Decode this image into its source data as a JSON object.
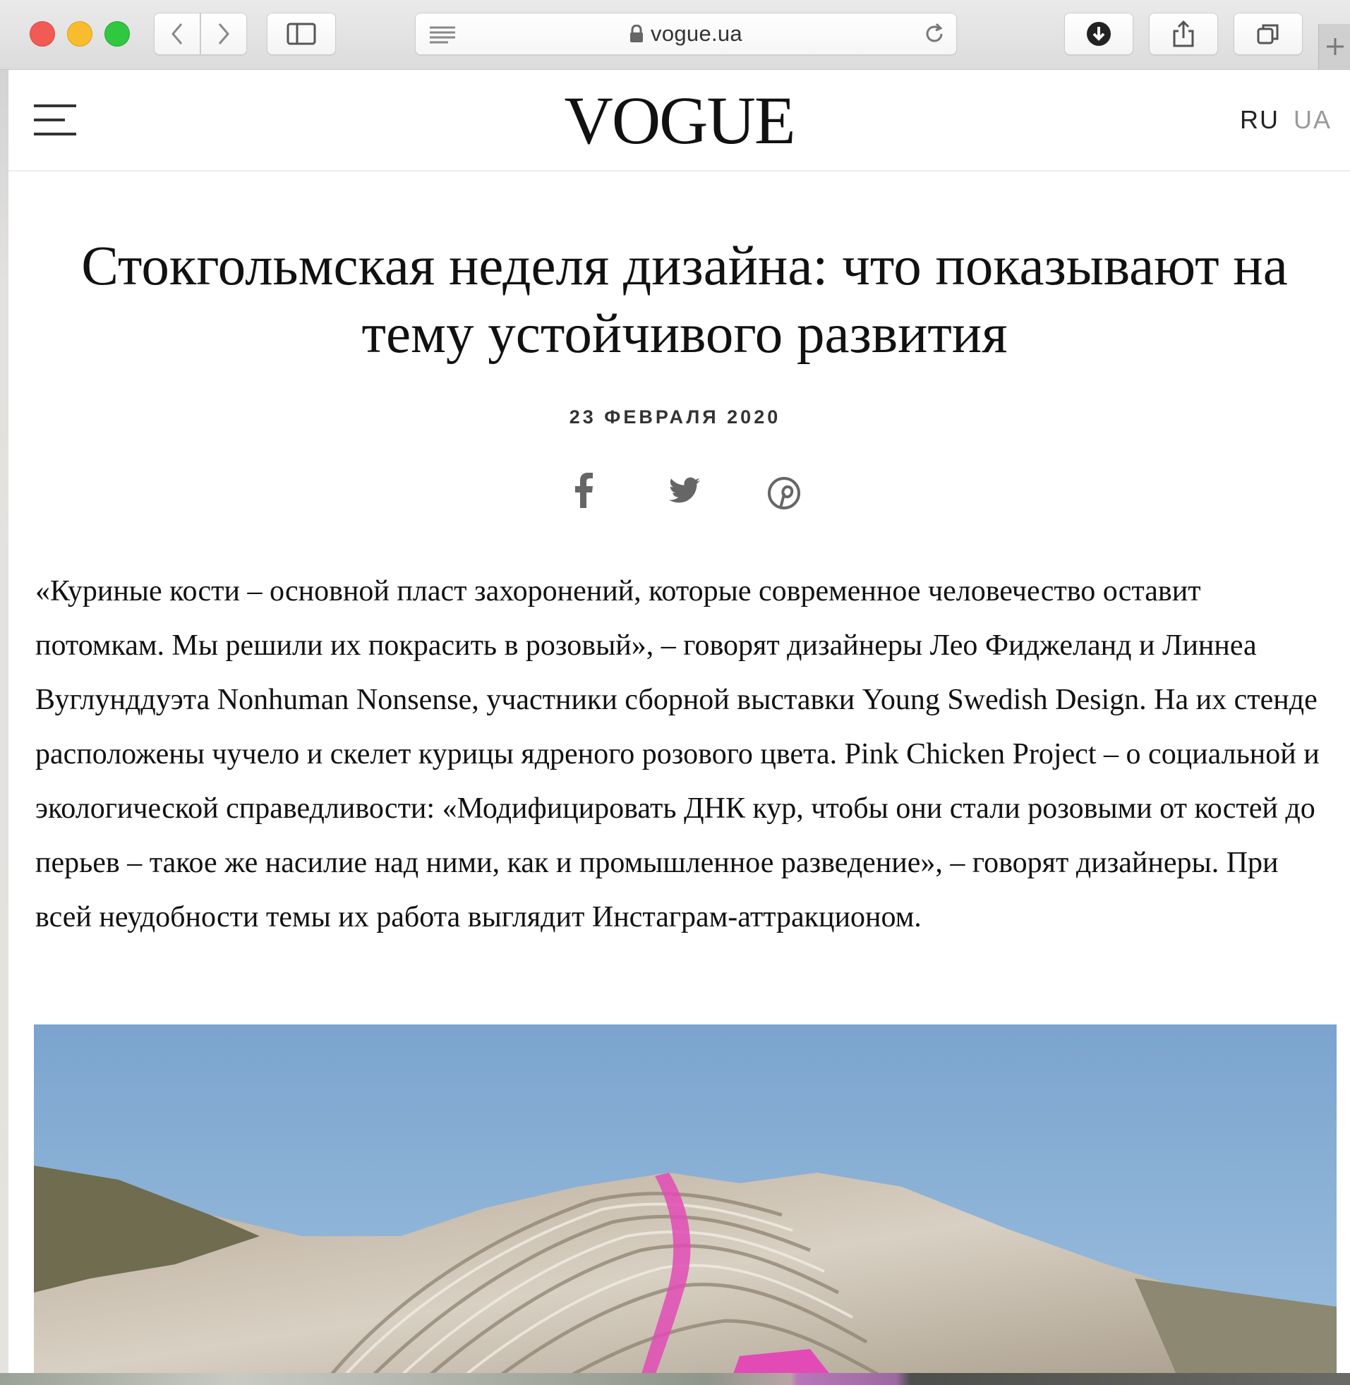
{
  "browser": {
    "url": "vogue.ua"
  },
  "header": {
    "logo": "VOGUE",
    "lang_ru": "RU",
    "lang_ua": "UA"
  },
  "article": {
    "title": "Стокгольмская неделя дизайна: что показывают на тему устойчивого развития",
    "date": "23 ФЕВРАЛЯ 2020",
    "body": "«Куриные кости – основной пласт захоронений, которые современное человечество оставит потомкам. Мы решили их покрасить в розовый», – говорят дизайнеры Лео Фиджеланд и Линнеа Вуглунддуэта Nonhuman Nonsense, участники сборной выставки Young Swedish Design. На их стенде расположены чучело и скелет курицы ядреного розового цвета. Pink Chicken Project – о социальной и экологической справедливости: «Модифицировать ДНК кур, чтобы они стали розовыми от костей до перьев – такое же насилие над ними, как и промышленное разведение», – говорят дизайнеры. При всей неудобности темы их работа выглядит Инстаграм-аттракционом."
  },
  "share": {
    "icons": [
      "facebook-icon",
      "twitter-icon",
      "pinterest-icon"
    ]
  },
  "colors": {
    "close": "#f25a56",
    "minimize": "#f7bd2c",
    "maximize": "#2fc840",
    "sky": "#7fa6cf",
    "pink": "#e24bb5"
  }
}
